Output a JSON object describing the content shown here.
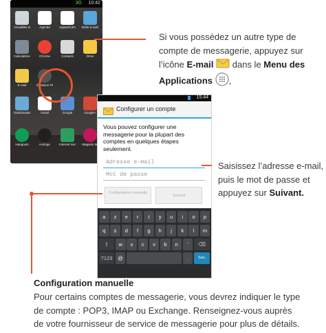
{
  "phone1": {
    "status_time": "10:42",
    "status_signal": "3G",
    "apps": [
      {
        "label": "Actualités et mét.",
        "icon": "news-icon",
        "color": "#cfd6dc"
      },
      {
        "label": "Agenda",
        "icon": "calendar-icon",
        "color": "#ffffff"
      },
      {
        "label": "Appareil photo",
        "icon": "camera-icon",
        "color": "#ffffff"
      },
      {
        "label": "Boîte à outils SIM",
        "icon": "sim-icon",
        "color": "#5aa7d9"
      },
      {
        "label": "Calculatrice",
        "icon": "calculator-icon",
        "color": "#7e8a94"
      },
      {
        "label": "Chrome",
        "icon": "chrome-icon",
        "color": "#e94235"
      },
      {
        "label": "Contacts",
        "icon": "contacts-icon",
        "color": "#d8d8d8"
      },
      {
        "label": "Drive",
        "icon": "drive-icon",
        "color": "#f7c844"
      },
      {
        "label": "E-mail",
        "icon": "email-icon",
        "color": "#f2c94c"
      },
      {
        "label": "Émission FM",
        "icon": "fm-radio-icon",
        "color": "#555555"
      },
      {
        "label": "Gestionnaire de fi",
        "icon": "file-manager-icon",
        "color": "#6aa9d8"
      },
      {
        "label": "Gmail",
        "icon": "gmail-icon",
        "color": "#ffffff"
      },
      {
        "label": "Google",
        "icon": "google-icon",
        "color": "#5b8fd6"
      },
      {
        "label": "Google+",
        "icon": "google-plus-icon",
        "color": "#d34836"
      },
      {
        "label": "Hangouts",
        "icon": "hangouts-icon",
        "color": "#0f9d58"
      },
      {
        "label": "Horloge",
        "icon": "clock-icon",
        "color": "#202020"
      },
      {
        "label": "Internet Security",
        "icon": "security-icon",
        "color": "#2e9e5f"
      },
      {
        "label": "Magasin de",
        "icon": "store-icon",
        "color": "#c2185b"
      }
    ]
  },
  "phone2": {
    "status_time": "15:44",
    "title": "Configurer un compte",
    "intro": "Vous pouvez configurer une messagerie pour la plupart des comptes en quelques étapes seulement.",
    "email_placeholder": "Adresse e-mail",
    "password_placeholder": "Mot de passe",
    "manual_setup_label": "Configuration manuelle",
    "next_label": "Suivant",
    "keyboard_rows": [
      [
        "a",
        "z",
        "e",
        "r",
        "t",
        "y",
        "u",
        "i",
        "o",
        "p"
      ],
      [
        "q",
        "s",
        "d",
        "f",
        "g",
        "h",
        "j",
        "k",
        "l",
        "m"
      ],
      [
        "w",
        "x",
        "c",
        "v",
        "b",
        "n",
        "'"
      ]
    ],
    "key_symbols": "?123",
    "key_at": "@",
    "key_period": ".",
    "key_go": "Suiv."
  },
  "callout1": {
    "part1": "Si vous possédez un autre type de",
    "part2": "compte de messagerie, appuyez sur",
    "part3": "l’icône",
    "email_bold": "E-mail",
    "part4": "dans le",
    "menu_bold": "Menu des",
    "applications_bold": "Applications",
    "trailing": ","
  },
  "callout2": {
    "line1": "Saisissez l’adresse e-mail,",
    "line2": "puis le mot de passe et",
    "line3_pre": "appuyez sur",
    "line3_bold": "Suivant."
  },
  "manual": {
    "heading": "Configuration manuelle",
    "line1": "Pour certains comptes de messagerie, vous devrez indiquer le type",
    "line2": "de compte : POP3, IMAP ou Exchange. Renseignez-vous auprès",
    "line3": "de votre fournisseur de service de messagerie pour plus de détails."
  },
  "colors": {
    "accent": "#e4572e",
    "android_blue": "#2ea5d8"
  }
}
